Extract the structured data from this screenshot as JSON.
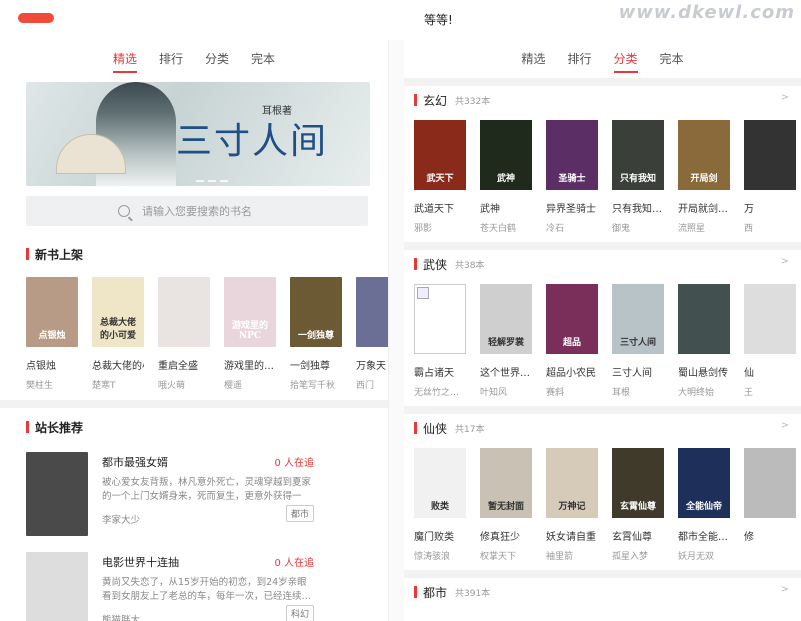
{
  "topbar": {
    "caption": "等等!",
    "watermark": "www.dkewl.com"
  },
  "left": {
    "tabs": [
      "精选",
      "排行",
      "分类",
      "完本"
    ],
    "active_tab": 0,
    "banner": {
      "title": "三寸人间",
      "subtitle": "耳根著"
    },
    "search": {
      "placeholder": "请输入您要搜索的书名"
    },
    "new_books": {
      "title": "新书上架",
      "items": [
        {
          "title": "点银烛",
          "author": "樊柱生",
          "color": "#b79b86",
          "cover_text": "点银烛",
          "cover_dark": false
        },
        {
          "title": "总裁大佬的小可",
          "author": "楚寒T",
          "color": "#efe6c8",
          "cover_text": "总裁大佬的小可爱",
          "cover_dark": true
        },
        {
          "title": "重启全盛",
          "author": "哦火萌",
          "color": "#e9e4e2",
          "cover_text": "",
          "cover_dark": true
        },
        {
          "title": "游戏里的…",
          "author": "樱遥",
          "color": "#e8d6dc",
          "cover_text": "游戏里的NPC",
          "cover_dark": false
        },
        {
          "title": "一剑独尊",
          "author": "拾笔写千秋",
          "color": "#6b5a33",
          "cover_text": "一剑独尊",
          "cover_dark": false
        },
        {
          "title": "万象天",
          "author": "西门",
          "color": "#6b6f96",
          "cover_text": "",
          "cover_dark": false
        }
      ]
    },
    "recommend": {
      "title": "站长推荐",
      "items": [
        {
          "title": "都市最强女婿",
          "reading": "0 人在追",
          "desc": "被心爱女友背叛，林凡意外死亡，灵魂穿越到夏家的一个上门女婿身来，死而复生，更意外获得一位…",
          "author": "李家大少",
          "tag": "都市",
          "color": "#4a4a4a"
        },
        {
          "title": "电影世界十连抽",
          "reading": "0 人在追",
          "desc": "黄尚又失恋了，从15岁开始的初恋，到24岁亲眼看到女朋友上了老总的车，每年一次，已经连续…",
          "author": "熊猫胖大",
          "tag": "科幻",
          "color": "#ddd"
        }
      ]
    }
  },
  "right": {
    "tabs": [
      "精选",
      "排行",
      "分类",
      "完本"
    ],
    "active_tab": 2,
    "categories": [
      {
        "name": "玄幻",
        "count": "共332本",
        "books": [
          {
            "title": "武道天下",
            "author": "邪影",
            "color": "#8a2a1a",
            "cover_text": "武天下"
          },
          {
            "title": "武神",
            "author": "苍天白鹤",
            "color": "#1f2a1c",
            "cover_text": "武神"
          },
          {
            "title": "异界圣骑士",
            "author": "冷石",
            "color": "#5b2e66",
            "cover_text": "圣骑士"
          },
          {
            "title": "只有我知…",
            "author": "御鬼",
            "color": "#3a3f3a",
            "cover_text": "只有我知"
          },
          {
            "title": "开局就剑…",
            "author": "流照星",
            "color": "#8a6a3a",
            "cover_text": "开局剑"
          },
          {
            "title": "万",
            "author": "西",
            "color": "#333",
            "cover_text": ""
          }
        ]
      },
      {
        "name": "武侠",
        "count": "共38本",
        "books": [
          {
            "title": "霸占诸天",
            "author": "无丝竹之…",
            "color": "broken",
            "cover_text": ""
          },
          {
            "title": "这个世界…",
            "author": "叶知风",
            "color": "#cfcfcf",
            "cover_text": "轻解罗裳"
          },
          {
            "title": "超品小农民",
            "author": "赛斜",
            "color": "#7a2f5a",
            "cover_text": "超品"
          },
          {
            "title": "三寸人间",
            "author": "耳根",
            "color": "#b7c3c6",
            "cover_text": "三寸人间"
          },
          {
            "title": "蜀山悬剑传",
            "author": "大明终始",
            "color": "#42514f",
            "cover_text": ""
          },
          {
            "title": "仙",
            "author": "王",
            "color": "#ddd",
            "cover_text": ""
          }
        ]
      },
      {
        "name": "仙侠",
        "count": "共17本",
        "books": [
          {
            "title": "魔门败类",
            "author": "惊涛骇浪",
            "color": "#f1f1f1",
            "cover_text": "败类"
          },
          {
            "title": "修真狂少",
            "author": "权掌天下",
            "color": "#c9c1b4",
            "cover_text": "暂无封面"
          },
          {
            "title": "妖女请自重",
            "author": "袖里箭",
            "color": "#d6cbb8",
            "cover_text": "万神记"
          },
          {
            "title": "玄霄仙尊",
            "author": "孤星入梦",
            "color": "#3f3a2a",
            "cover_text": "玄霄仙尊"
          },
          {
            "title": "都市全能…",
            "author": "妖月无双",
            "color": "#1e2f5a",
            "cover_text": "全能仙帝"
          },
          {
            "title": "修",
            "author": "",
            "color": "#bbb",
            "cover_text": ""
          }
        ]
      },
      {
        "name": "都市",
        "count": "共391本",
        "books": []
      }
    ]
  }
}
